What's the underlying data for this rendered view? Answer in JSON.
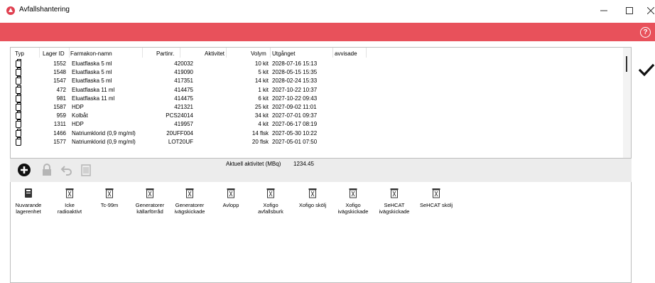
{
  "window": {
    "title": "Avfallshantering"
  },
  "banner": {
    "help_glyph": "?"
  },
  "table": {
    "headers": {
      "typ": "Typ",
      "lager_id": "Lager ID",
      "farmakon": "Farmakon-namn",
      "partinr": "Partinr.",
      "aktivitet": "Aktivitet",
      "volym": "Volym",
      "utgang": "Utgånget",
      "avvisade": "avvisade"
    },
    "rows": [
      {
        "id": "1552",
        "name": "Eluatflaska 5 ml",
        "parti": "420032",
        "volym": "10 kit",
        "utg": "2028-07-16 15:13"
      },
      {
        "id": "1548",
        "name": "Eluatflaska 5 ml",
        "parti": "419090",
        "volym": "5 kit",
        "utg": "2028-05-15 15:35"
      },
      {
        "id": "1547",
        "name": "Eluatflaska 5 ml",
        "parti": "417351",
        "volym": "14 kit",
        "utg": "2028-02-24 15:33"
      },
      {
        "id": "472",
        "name": "Eluatflaska 11 ml",
        "parti": "414475",
        "volym": "1 kit",
        "utg": "2027-10-22 10:37"
      },
      {
        "id": "981",
        "name": "Eluatflaska 11 ml",
        "parti": "414475",
        "volym": "6 kit",
        "utg": "2027-10-22 09:43"
      },
      {
        "id": "1587",
        "name": "HDP",
        "parti": "421321",
        "volym": "25 kit",
        "utg": "2027-09-02 11:01"
      },
      {
        "id": "959",
        "name": "Kolbåt",
        "parti": "PCS24014",
        "volym": "34 kit",
        "utg": "2027-07-01 09:37"
      },
      {
        "id": "1311",
        "name": "HDP",
        "parti": "419957",
        "volym": "4 kit",
        "utg": "2027-06-17 08:19"
      },
      {
        "id": "1466",
        "name": "Natriumklorid (0,9 mg/ml)",
        "parti": "20UFF004",
        "volym": "14 flsk",
        "utg": "2027-05-30 10:22"
      },
      {
        "id": "1577",
        "name": "Natriumklorid (0,9 mg/ml)",
        "parti": "LOT20UF",
        "volym": "20 flsk",
        "utg": "2027-05-01 07:50"
      }
    ]
  },
  "toolbar": {
    "activity_label": "Aktuell aktivitet (MBq)",
    "activity_value": "1234.45"
  },
  "icons": {
    "add": "plus-circle-icon",
    "lock": "lock-icon",
    "undo": "undo-icon",
    "scanner": "scanner-icon",
    "confirm": "checkmark-icon"
  },
  "waste": [
    {
      "line1": "Nuvarande",
      "line2": "lagerenhet"
    },
    {
      "line1": "Icke",
      "line2": "radioaktivt"
    },
    {
      "line1": "Tc-99m",
      "line2": ""
    },
    {
      "line1": "Generatorer",
      "line2": "källarförråd"
    },
    {
      "line1": "Generatorer",
      "line2": "ivägskickade"
    },
    {
      "line1": "Avlopp",
      "line2": ""
    },
    {
      "line1": "Xofigo",
      "line2": "avfallsburk"
    },
    {
      "line1": "Xofigo skölj",
      "line2": ""
    },
    {
      "line1": "Xofigo",
      "line2": "ivägskickade"
    },
    {
      "line1": "SeHCAT",
      "line2": "ivägskickade"
    },
    {
      "line1": "SeHCAT skölj",
      "line2": ""
    }
  ],
  "colors": {
    "banner": "#e8515b",
    "toolbar_bg": "#ececec",
    "disabled_icon": "#b5b5b5"
  }
}
